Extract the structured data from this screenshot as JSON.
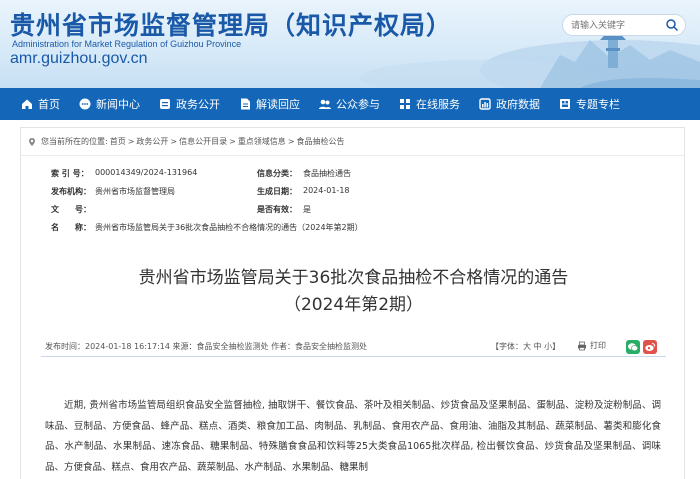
{
  "header": {
    "title": "贵州省市场监督管理局（知识产权局）",
    "subtitle": "Administration for Market Regulation of Guizhou Province",
    "url": "amr.guizhou.gov.cn",
    "search_placeholder": "请输入关键字"
  },
  "nav": {
    "items": [
      {
        "label": "首页",
        "icon": "home-icon"
      },
      {
        "label": "新闻中心",
        "icon": "chat-icon"
      },
      {
        "label": "政务公开",
        "icon": "document-icon"
      },
      {
        "label": "解读回应",
        "icon": "file-icon"
      },
      {
        "label": "公众参与",
        "icon": "people-icon"
      },
      {
        "label": "在线服务",
        "icon": "grid-icon"
      },
      {
        "label": "政府数据",
        "icon": "chart-icon"
      },
      {
        "label": "专题专栏",
        "icon": "folder-icon"
      }
    ]
  },
  "breadcrumb": {
    "prefix": "您当前所在的位置:",
    "items": [
      "首页",
      "政务公开",
      "信息公开目录",
      "重点领域信息",
      "食品抽检公告"
    ],
    "separator": ">"
  },
  "meta": {
    "index_label": "索 引 号：",
    "index_value": "000014349/2024-131964",
    "category_label": "信息分类：",
    "category_value": "食品抽检通告",
    "publisher_label": "发布机构：",
    "publisher_value": "贵州省市场监督管理局",
    "date_label": "生成日期：",
    "date_value": "2024-01-18",
    "docno_label": "文　　号：",
    "docno_value": "",
    "valid_label": "是否有效：",
    "valid_value": "是",
    "name_label": "名　　称：",
    "name_value": "贵州省市场监管局关于36批次食品抽检不合格情况的通告（2024年第2期）"
  },
  "article": {
    "title_line1": "贵州省市场监管局关于36批次食品抽检不合格情况的通告",
    "title_line2": "（2024年第2期）",
    "publish_time": "发布时间：2024-01-18 16:17:14",
    "source": "来源：食品安全抽检监测处",
    "author": "作者：食品安全抽检监测处",
    "font_size_label": "【字体：大 中 小】",
    "print_label": "打印",
    "body": "近期, 贵州省市场监管局组织食品安全监督抽检, 抽取饼干、餐饮食品、茶叶及相关制品、炒货食品及坚果制品、蛋制品、淀粉及淀粉制品、调味品、豆制品、方便食品、蜂产品、糕点、酒类、粮食加工品、肉制品、乳制品、食用农产品、食用油、油脂及其制品、蔬菜制品、薯类和膨化食品、水产制品、水果制品、速冻食品、糖果制品、特殊膳食食品和饮料等25大类食品1065批次样品, 检出餐饮食品、炒货食品及坚果制品、调味品、方便食品、糕点、食用农产品、蔬菜制品、水产制品、水果制品、糖果制"
  },
  "colors": {
    "brand_blue": "#1a59a8",
    "nav_blue": "#1466b8",
    "wechat_green": "#2aae67",
    "weibo_red": "#e0524a"
  }
}
